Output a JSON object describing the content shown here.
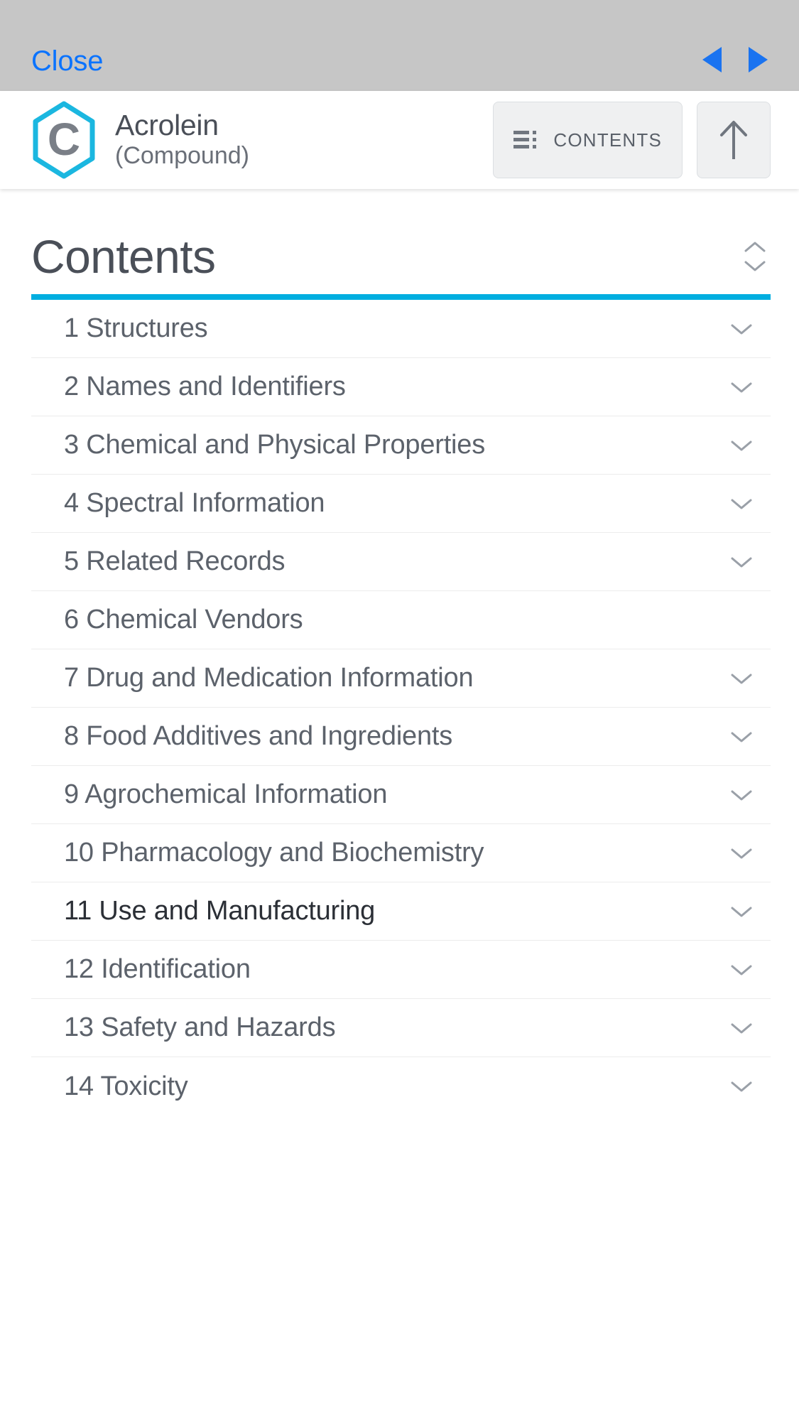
{
  "browser_bar": {
    "close_label": "Close",
    "back_icon": "triangle-left-icon",
    "forward_icon": "triangle-right-icon",
    "background_color": "#c6c6c6",
    "link_color": "#0a73ff"
  },
  "record_header": {
    "logo_icon": "hexagon-compound-c-icon",
    "logo_color": "#1bb7e0",
    "logo_letter": "C",
    "title": "Acrolein",
    "subtitle": "(Compound)",
    "contents_button": {
      "label": "CONTENTS",
      "icon": "list-lines-icon"
    },
    "scroll_top_button": {
      "icon": "arrow-up-icon"
    }
  },
  "contents": {
    "heading": "Contents",
    "collapse_toggle_icon": "chevron-up-down-icon",
    "accent_color": "#00aee0",
    "active_section": "11 Use and Manufacturing",
    "items": [
      {
        "label": "1 Structures",
        "expandable": true,
        "active": false
      },
      {
        "label": "2 Names and Identifiers",
        "expandable": true,
        "active": false
      },
      {
        "label": "3 Chemical and Physical Properties",
        "expandable": true,
        "active": false
      },
      {
        "label": "4 Spectral Information",
        "expandable": true,
        "active": false
      },
      {
        "label": "5 Related Records",
        "expandable": true,
        "active": false
      },
      {
        "label": "6 Chemical Vendors",
        "expandable": false,
        "active": false
      },
      {
        "label": "7 Drug and Medication Information",
        "expandable": true,
        "active": false
      },
      {
        "label": "8 Food Additives and Ingredients",
        "expandable": true,
        "active": false
      },
      {
        "label": "9 Agrochemical Information",
        "expandable": true,
        "active": false
      },
      {
        "label": "10 Pharmacology and Biochemistry",
        "expandable": true,
        "active": false
      },
      {
        "label": "11 Use and Manufacturing",
        "expandable": true,
        "active": true
      },
      {
        "label": "12 Identification",
        "expandable": true,
        "active": false
      },
      {
        "label": "13 Safety and Hazards",
        "expandable": true,
        "active": false
      },
      {
        "label": "14 Toxicity",
        "expandable": true,
        "active": false
      }
    ]
  }
}
